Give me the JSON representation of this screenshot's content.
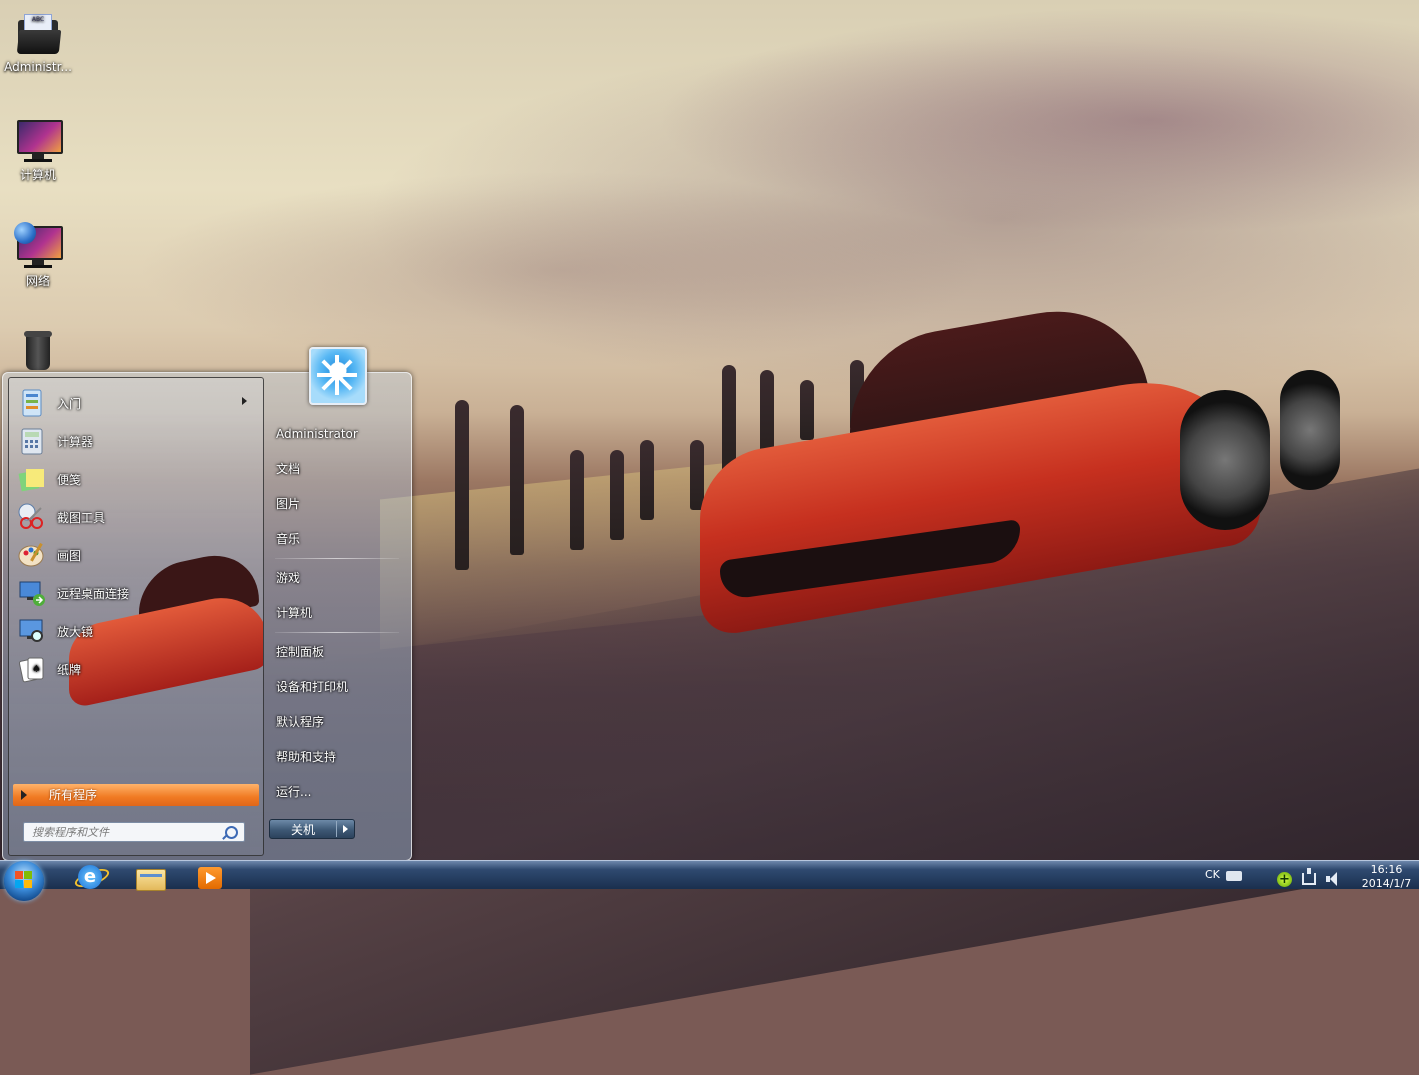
{
  "desktop": {
    "icons": [
      {
        "label": "Administr...",
        "icon": "user-folder-icon"
      },
      {
        "label": "计算机",
        "icon": "computer-icon"
      },
      {
        "label": "网络",
        "icon": "network-icon"
      },
      {
        "label": "",
        "icon": "recycle-bin-icon"
      }
    ]
  },
  "start_menu": {
    "programs": [
      {
        "label": "入门",
        "icon": "getting-started-icon",
        "has_submenu": true
      },
      {
        "label": "计算器",
        "icon": "calculator-icon"
      },
      {
        "label": "便笺",
        "icon": "sticky-notes-icon"
      },
      {
        "label": "截图工具",
        "icon": "snipping-tool-icon"
      },
      {
        "label": "画图",
        "icon": "paint-icon"
      },
      {
        "label": "远程桌面连接",
        "icon": "remote-desktop-icon"
      },
      {
        "label": "放大镜",
        "icon": "magnifier-icon"
      },
      {
        "label": "纸牌",
        "icon": "solitaire-icon"
      }
    ],
    "all_programs": "所有程序",
    "search_placeholder": "搜索程序和文件",
    "user_name": "Administrator",
    "right_items": [
      {
        "label": "文档"
      },
      {
        "label": "图片"
      },
      {
        "label": "音乐"
      },
      {
        "label": "游戏"
      },
      {
        "label": "计算机"
      },
      {
        "label": "控制面板"
      },
      {
        "label": "设备和打印机"
      },
      {
        "label": "默认程序"
      },
      {
        "label": "帮助和支持"
      },
      {
        "label": "运行..."
      }
    ],
    "shutdown_label": "关机"
  },
  "taskbar": {
    "pinned": [
      {
        "icon": "internet-explorer-icon"
      },
      {
        "icon": "windows-explorer-icon"
      },
      {
        "icon": "media-player-icon"
      }
    ],
    "tray": {
      "language": "CK",
      "time": "16:16",
      "date": "2014/1/7"
    }
  },
  "colors": {
    "all_programs_bg": "#f07a22",
    "taskbar_bg": "#1a2f4e",
    "car_red": "#c6301f"
  }
}
